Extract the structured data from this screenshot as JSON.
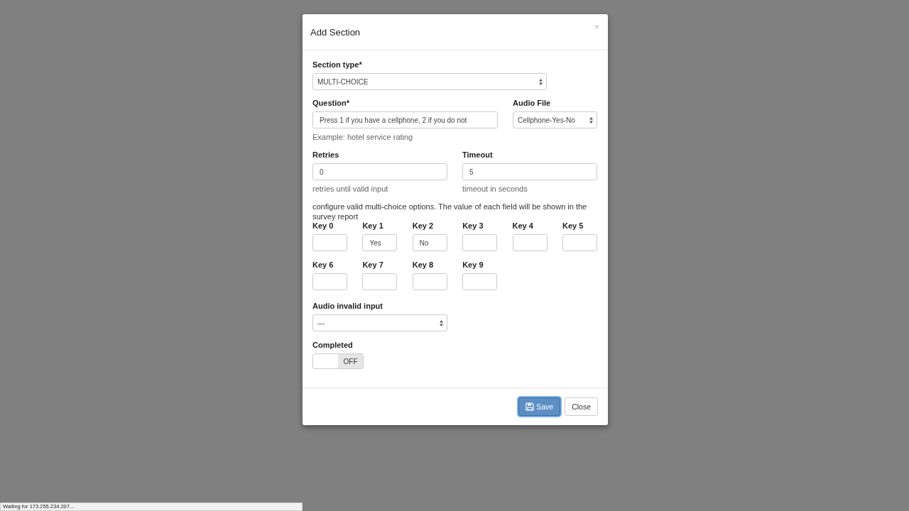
{
  "dialog": {
    "title": "Add Section",
    "close": "×"
  },
  "section_type": {
    "label": "Section type*",
    "value": "MULTI-CHOICE"
  },
  "question": {
    "label": "Question*",
    "value": "Press 1 if you have a cellphone, 2 if you do not",
    "help": "Example: hotel service rating"
  },
  "audio_file": {
    "label": "Audio File",
    "value": "Cellphone-Yes-No"
  },
  "retries": {
    "label": "Retries",
    "value": "0",
    "help": "retries until valid input"
  },
  "timeout": {
    "label": "Timeout",
    "value": "5",
    "help": "timeout in seconds"
  },
  "keys_note": "configure valid multi-choice options. The value of each field will be shown in the survey report",
  "keys": [
    {
      "label": "Key 0"
    },
    {
      "label": "Key 1",
      "value": "Yes"
    },
    {
      "label": "Key 2",
      "value": "No"
    },
    {
      "label": "Key 3"
    },
    {
      "label": "Key 4"
    },
    {
      "label": "Key 5"
    },
    {
      "label": "Key 6"
    },
    {
      "label": "Key 7"
    },
    {
      "label": "Key 8"
    },
    {
      "label": "Key 9"
    }
  ],
  "audio_invalid": {
    "label": "Audio invalid input",
    "value": "---"
  },
  "completed": {
    "label": "Completed",
    "on": false,
    "state_text": "OFF"
  },
  "buttons": [
    {
      "label": "Save",
      "kind": "primary",
      "focused": true
    },
    {
      "label": "Close",
      "kind": "default",
      "focused": false
    }
  ],
  "status_bar": "Waiting for 173.255.234.207..."
}
